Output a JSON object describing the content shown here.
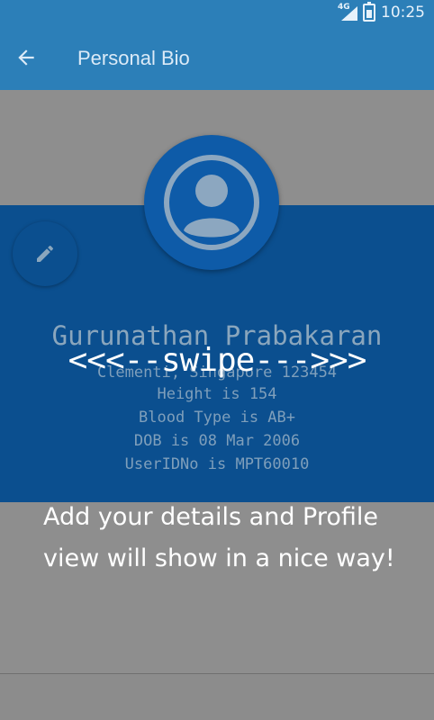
{
  "status_bar": {
    "network": "4G",
    "time": "10:25"
  },
  "app_bar": {
    "title": "Personal Bio",
    "back_icon": "arrow-left-icon"
  },
  "profile": {
    "avatar_icon": "account-circle-icon",
    "edit_icon": "pencil-icon",
    "name": "Gurunathan Prabakaran",
    "address": "Clementi, Singapore 123454",
    "height": "Height is 154",
    "blood_type": "Blood Type is AB+",
    "dob": "DOB is 08 Mar 2006",
    "user_id": "UserIDNo is MPT60010"
  },
  "tutorial": {
    "swipe": "<<<--swipe--->>>",
    "message": "Add your details and Profile view will show in a nice way!"
  },
  "colors": {
    "app_bar": "#2c7fb8",
    "card": "#0b4f8f",
    "overlay_gray": "#8e8e8e",
    "text_white": "#ffffff"
  }
}
